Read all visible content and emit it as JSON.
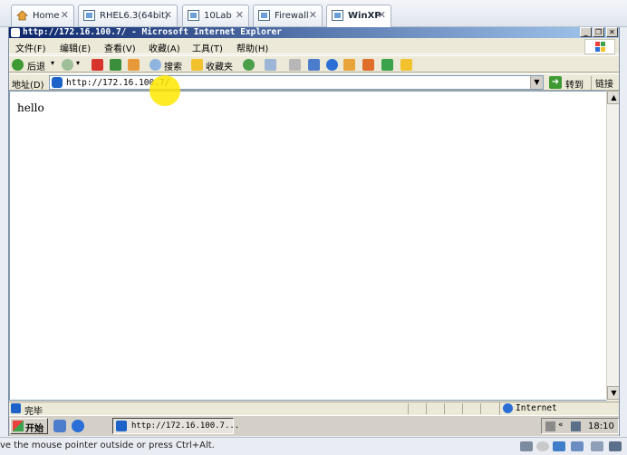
{
  "host_tabs": [
    {
      "label": "Home",
      "icon": "home-icon"
    },
    {
      "label": "RHEL6.3(64bit)",
      "icon": "vm-icon"
    },
    {
      "label": "10Lab",
      "icon": "vm-icon"
    },
    {
      "label": "Firewall",
      "icon": "vm-icon"
    },
    {
      "label": "WinXP",
      "icon": "vm-icon",
      "active": true
    }
  ],
  "tab_close_glyph": "✕",
  "ie": {
    "title": "http://172.16.100.7/ - Microsoft Internet Explorer",
    "window_buttons": {
      "minimize": "_",
      "restore": "❐",
      "close": "✕"
    },
    "menu": [
      "文件(F)",
      "编辑(E)",
      "查看(V)",
      "收藏(A)",
      "工具(T)",
      "帮助(H)"
    ],
    "toolbar": {
      "back": "后退",
      "search": "搜索",
      "favorites": "收藏夹"
    },
    "address_label": "地址(D)",
    "address_value": "http://172.16.100.7/",
    "go_label": "转到",
    "links_label": "链接",
    "page_text": "hello",
    "status_text": "完毕",
    "zone": "Internet"
  },
  "taskbar": {
    "start_label": "开始",
    "task_label": "http://172.16.100.7...",
    "clock": "18:10"
  },
  "host_status": "ve the mouse pointer outside or press Ctrl+Alt.",
  "colors": {
    "title_start": "#0a246a",
    "title_end": "#a6caf0",
    "highlight": "#ffe600",
    "go_green": "#3f9a34"
  }
}
